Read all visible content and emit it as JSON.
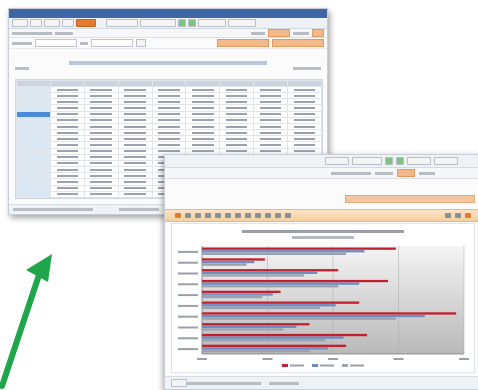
{
  "colors": {
    "title_bar": "#3f66a6",
    "accent": "#e07b2f",
    "arrow": "#1fa64a",
    "bar_red": "#c21f2f",
    "bar_blue": "#6f8bc0",
    "bar_gray": "#9aa3ad"
  },
  "table": {
    "columns": 8,
    "rows": [
      {
        "cat": "",
        "hl": false
      },
      {
        "cat": "",
        "hl": false
      },
      {
        "cat": "",
        "hl": false
      },
      {
        "cat": "",
        "hl": false
      },
      {
        "cat": "",
        "hl": true
      },
      {
        "cat": "",
        "hl": false
      },
      {
        "cat": "",
        "hl": false
      },
      {
        "cat": "",
        "hl": false
      },
      {
        "cat": "",
        "hl": false
      },
      {
        "cat": "",
        "hl": false
      },
      {
        "cat": "",
        "hl": false
      },
      {
        "cat": "",
        "hl": false
      },
      {
        "cat": "",
        "hl": false
      },
      {
        "cat": "",
        "hl": false
      },
      {
        "cat": "",
        "hl": false
      },
      {
        "cat": "",
        "hl": false
      },
      {
        "cat": "",
        "hl": false
      },
      {
        "cat": "",
        "hl": false
      }
    ]
  },
  "chart_data": {
    "type": "bar",
    "orientation": "horizontal",
    "categories": [
      "",
      "",
      "",
      "",
      "",
      "",
      "",
      "",
      "",
      ""
    ],
    "series": [
      {
        "values": [
          0.74,
          0.24,
          0.52,
          0.71,
          0.3,
          0.6,
          0.97,
          0.41,
          0.63,
          0.55
        ]
      },
      {
        "values": [
          0.62,
          0.2,
          0.44,
          0.6,
          0.27,
          0.51,
          0.85,
          0.36,
          0.54,
          0.48
        ]
      },
      {
        "values": [
          0.55,
          0.17,
          0.39,
          0.52,
          0.23,
          0.45,
          0.74,
          0.31,
          0.47,
          0.41
        ]
      }
    ],
    "xlim": [
      0,
      1
    ],
    "grid": true,
    "legend_position": "bottom"
  },
  "icons": {
    "toolbar": [
      "print-icon",
      "save-icon",
      "chart-icon",
      "export-icon",
      "zoom-icon",
      "settings-icon"
    ],
    "arrow": "arrow-up-right-icon"
  }
}
